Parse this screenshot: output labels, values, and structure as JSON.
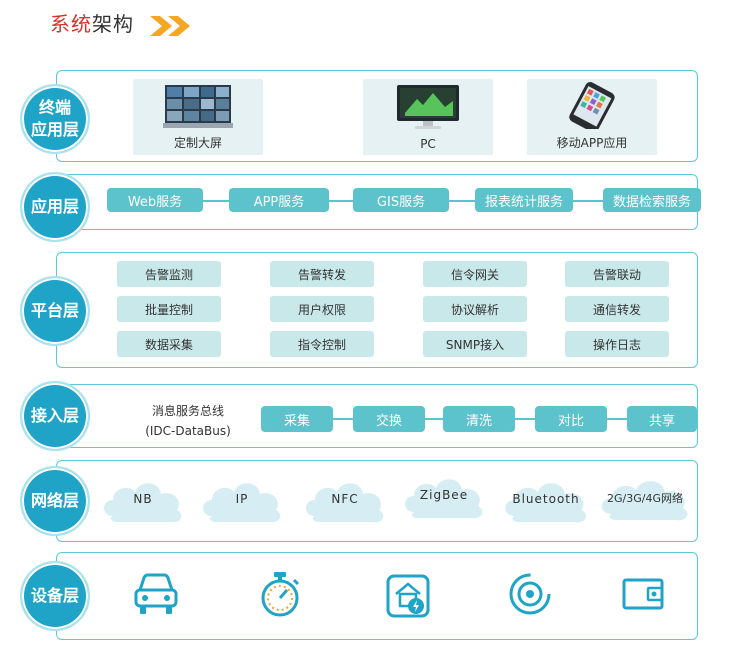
{
  "title": {
    "part1": "系统",
    "part2": "架构"
  },
  "layers": {
    "terminal": "终端\n应用层",
    "app": "应用层",
    "platform": "平台层",
    "access": "接入层",
    "network": "网络层",
    "device": "设备层"
  },
  "terminals": [
    {
      "label": "定制大屏",
      "icon": "video-wall-icon"
    },
    {
      "label": "PC",
      "icon": "monitor-icon"
    },
    {
      "label": "移动APP应用",
      "icon": "smartphone-icon"
    }
  ],
  "services": [
    "Web服务",
    "APP服务",
    "GIS服务",
    "报表统计服务",
    "数据检索服务"
  ],
  "platform_items": [
    [
      "告警监测",
      "告警转发",
      "信令网关",
      "告警联动"
    ],
    [
      "批量控制",
      "用户权限",
      "协议解析",
      "通信转发"
    ],
    [
      "数据采集",
      "指令控制",
      "SNMP接入",
      "操作日志"
    ]
  ],
  "access": {
    "bus_line1": "消息服务总线",
    "bus_line2": "(IDC-DataBus)",
    "steps": [
      "采集",
      "交换",
      "清洗",
      "对比",
      "共享"
    ]
  },
  "networks": [
    "NB",
    "IP",
    "NFC",
    "ZigBee",
    "Bluetooth",
    "2G/3G/4G网络"
  ],
  "devices": [
    "car-icon",
    "stopwatch-icon",
    "smart-home-icon",
    "sensor-icon",
    "wallet-icon"
  ],
  "colors": {
    "accent": "#1fa3c7",
    "pill": "#5cc3cc",
    "chip": "#c9e8ea",
    "border": "#5cc9d6",
    "title_red": "#d2322d",
    "arrow": "#f5a623"
  }
}
